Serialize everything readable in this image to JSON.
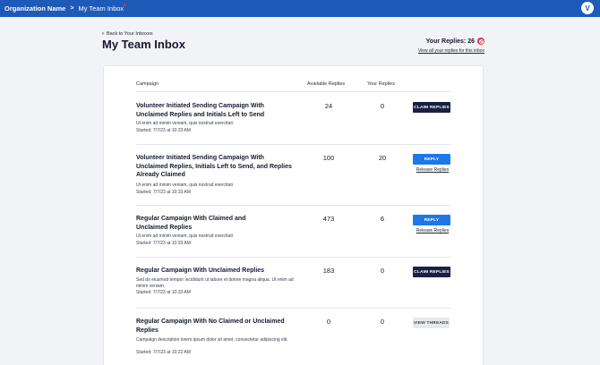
{
  "topbar": {
    "org_name": "Organization Name",
    "separator": ">",
    "current_page": "My Team Inbox",
    "avatar_initial": "V",
    "bar_color": "#1e5ab7"
  },
  "header": {
    "back_label": "Back to Your Inboxes",
    "title": "My Team Inbox",
    "your_replies_label": "Your Replies: 26",
    "view_all_label": "View all your replies for this inbox"
  },
  "table": {
    "columns": {
      "campaign": "Campaign",
      "available": "Available Replies",
      "yours": "Your Replies"
    },
    "rows": [
      {
        "title": "Volunteer Initiated Sending Campaign With Unclaimed Replies and Initials Left to Send",
        "description": "Ut enim ad minim veniam, quis nostrud exercitati",
        "started": "Started: 7/7/23 at 10:33 AM",
        "available": "24",
        "yours": "0",
        "action": "CLAIM REPLIES",
        "release": ""
      },
      {
        "title": "Volunteer Initiated Sending Campaign With Unclaimed Replies, Initials Left to Send, and Replies Already Claimed",
        "description": "Ut enim ad minim veniam, quis nostrud exercitati",
        "started": "Started: 7/7/23 at 10:33 AM",
        "available": "100",
        "yours": "20",
        "action": "REPLY",
        "release": "Release Replies"
      },
      {
        "title": "Regular Campaign With Claimed and Unclaimed Replies",
        "description": "Ut enim ad minim veniam, quis nostrud exercitati",
        "started": "Started: 7/7/23 at 10:33 AM",
        "available": "473",
        "yours": "6",
        "action": "REPLY",
        "release": "Release Replies"
      },
      {
        "title": "Regular Campaign With Unclaimed Replies",
        "description": "Sed do eiusmod tempor incididunt ut labore et dolore magna aliqua. Ut enim ad minim veniam.",
        "started": "Started: 7/7/23 at 10:33 AM",
        "available": "183",
        "yours": "0",
        "action": "CLAIM REPLIES",
        "release": ""
      },
      {
        "title": "Regular Campaign With No Claimed or Unclaimed Replies",
        "description": "Campaign description lorem ipsum dolor sit amet, consectetur adipiscing elit.",
        "started": "Started: 7/7/23 at 10:22 AM",
        "available": "0",
        "yours": "0",
        "action": "VIEW THREADS",
        "release": ""
      }
    ]
  },
  "icons": {
    "back": "chevron-left-icon",
    "replies_badge": "no-entry-icon"
  }
}
